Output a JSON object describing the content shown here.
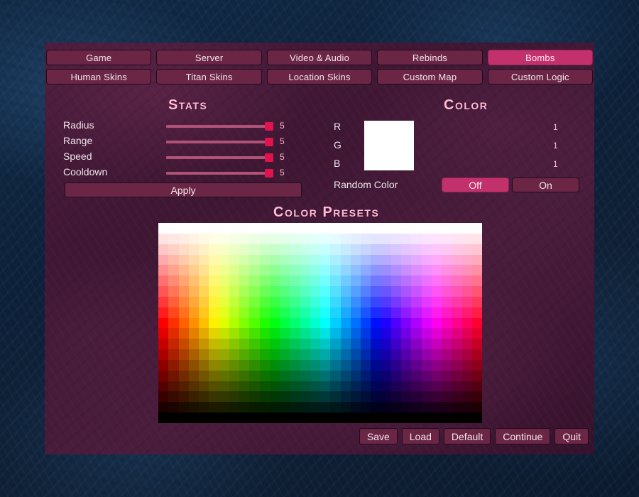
{
  "theme": {
    "accent": "#c3316c",
    "button_bg": "#6b2646",
    "heading_color": "#ffbcd6",
    "slider_track": "#b05377",
    "slider_handle": "#e0134f",
    "panel_bg": "#4a1c3c",
    "backdrop": "#0d2038"
  },
  "tabs": {
    "row1": [
      {
        "label": "Game",
        "active": false
      },
      {
        "label": "Server",
        "active": false
      },
      {
        "label": "Video & Audio",
        "active": false
      },
      {
        "label": "Rebinds",
        "active": false
      },
      {
        "label": "Bombs",
        "active": true
      }
    ],
    "row2": [
      {
        "label": "Human Skins",
        "active": false
      },
      {
        "label": "Titan Skins",
        "active": false
      },
      {
        "label": "Location Skins",
        "active": false
      },
      {
        "label": "Custom Map",
        "active": false
      },
      {
        "label": "Custom Logic",
        "active": false
      }
    ]
  },
  "stats": {
    "heading": "Stats",
    "apply_label": "Apply",
    "rows": [
      {
        "label": "Radius",
        "value": "5",
        "fill_pct": 100
      },
      {
        "label": "Range",
        "value": "5",
        "fill_pct": 100
      },
      {
        "label": "Speed",
        "value": "5",
        "fill_pct": 100
      },
      {
        "label": "Cooldown",
        "value": "5",
        "fill_pct": 100
      }
    ]
  },
  "color": {
    "heading": "Color",
    "swatch_hex": "#ffffff",
    "channels": [
      {
        "label": "R",
        "value": "1",
        "fill_pct": 100
      },
      {
        "label": "G",
        "value": "1",
        "fill_pct": 100
      },
      {
        "label": "B",
        "value": "1",
        "fill_pct": 100
      }
    ],
    "random_color": {
      "label": "Random Color",
      "off_label": "Off",
      "on_label": "On",
      "selected": "Off"
    }
  },
  "presets": {
    "heading": "Color Presets",
    "columns": 32,
    "rows": 19,
    "description": "hue sweep red-to-magenta across columns, lightness white-to-black down rows"
  },
  "bottom_buttons": [
    {
      "label": "Save"
    },
    {
      "label": "Load"
    },
    {
      "label": "Default"
    },
    {
      "label": "Continue"
    },
    {
      "label": "Quit"
    }
  ]
}
